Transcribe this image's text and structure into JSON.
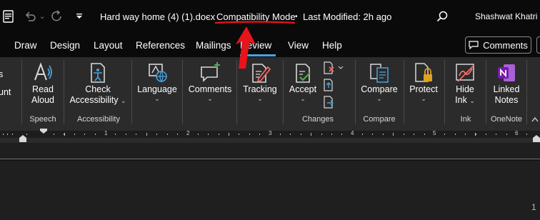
{
  "titlebar": {
    "document_name": "Hard way home (4) (1).docx",
    "separator": "-",
    "compatibility_mode": "Compatibility Mode",
    "dot": "•",
    "last_modified": "Last Modified: 2h ago",
    "user_name": "Shashwat Khatri"
  },
  "tabs": [
    "Draw",
    "Design",
    "Layout",
    "References",
    "Mailings",
    "Review",
    "View",
    "Help"
  ],
  "comments_button": "Comments",
  "ribbon": {
    "partial_left": {
      "line1": "s",
      "line2": "unt"
    },
    "read_aloud": {
      "line1": "Read",
      "line2": "Aloud"
    },
    "check_accessibility": {
      "line1": "Check",
      "line2": "Accessibility"
    },
    "language": "Language",
    "comments": "Comments",
    "tracking": "Tracking",
    "accept": "Accept",
    "compare": "Compare",
    "protect": "Protect",
    "hide_ink": {
      "line1": "Hide",
      "line2": "Ink"
    },
    "linked_notes": {
      "line1": "Linked",
      "line2": "Notes"
    },
    "groups": {
      "speech": "Speech",
      "accessibility": "Accessibility",
      "changes": "Changes",
      "compare": "Compare",
      "ink": "Ink",
      "onenote": "OneNote"
    }
  },
  "ruler_numbers": [
    "1",
    "2",
    "3",
    "4",
    "5",
    "6"
  ],
  "page_number_fragment": "1",
  "colors": {
    "annotation_red": "#e8141c",
    "onenote_purple": "#7719aa",
    "accent_teal": "#4aa3df"
  }
}
